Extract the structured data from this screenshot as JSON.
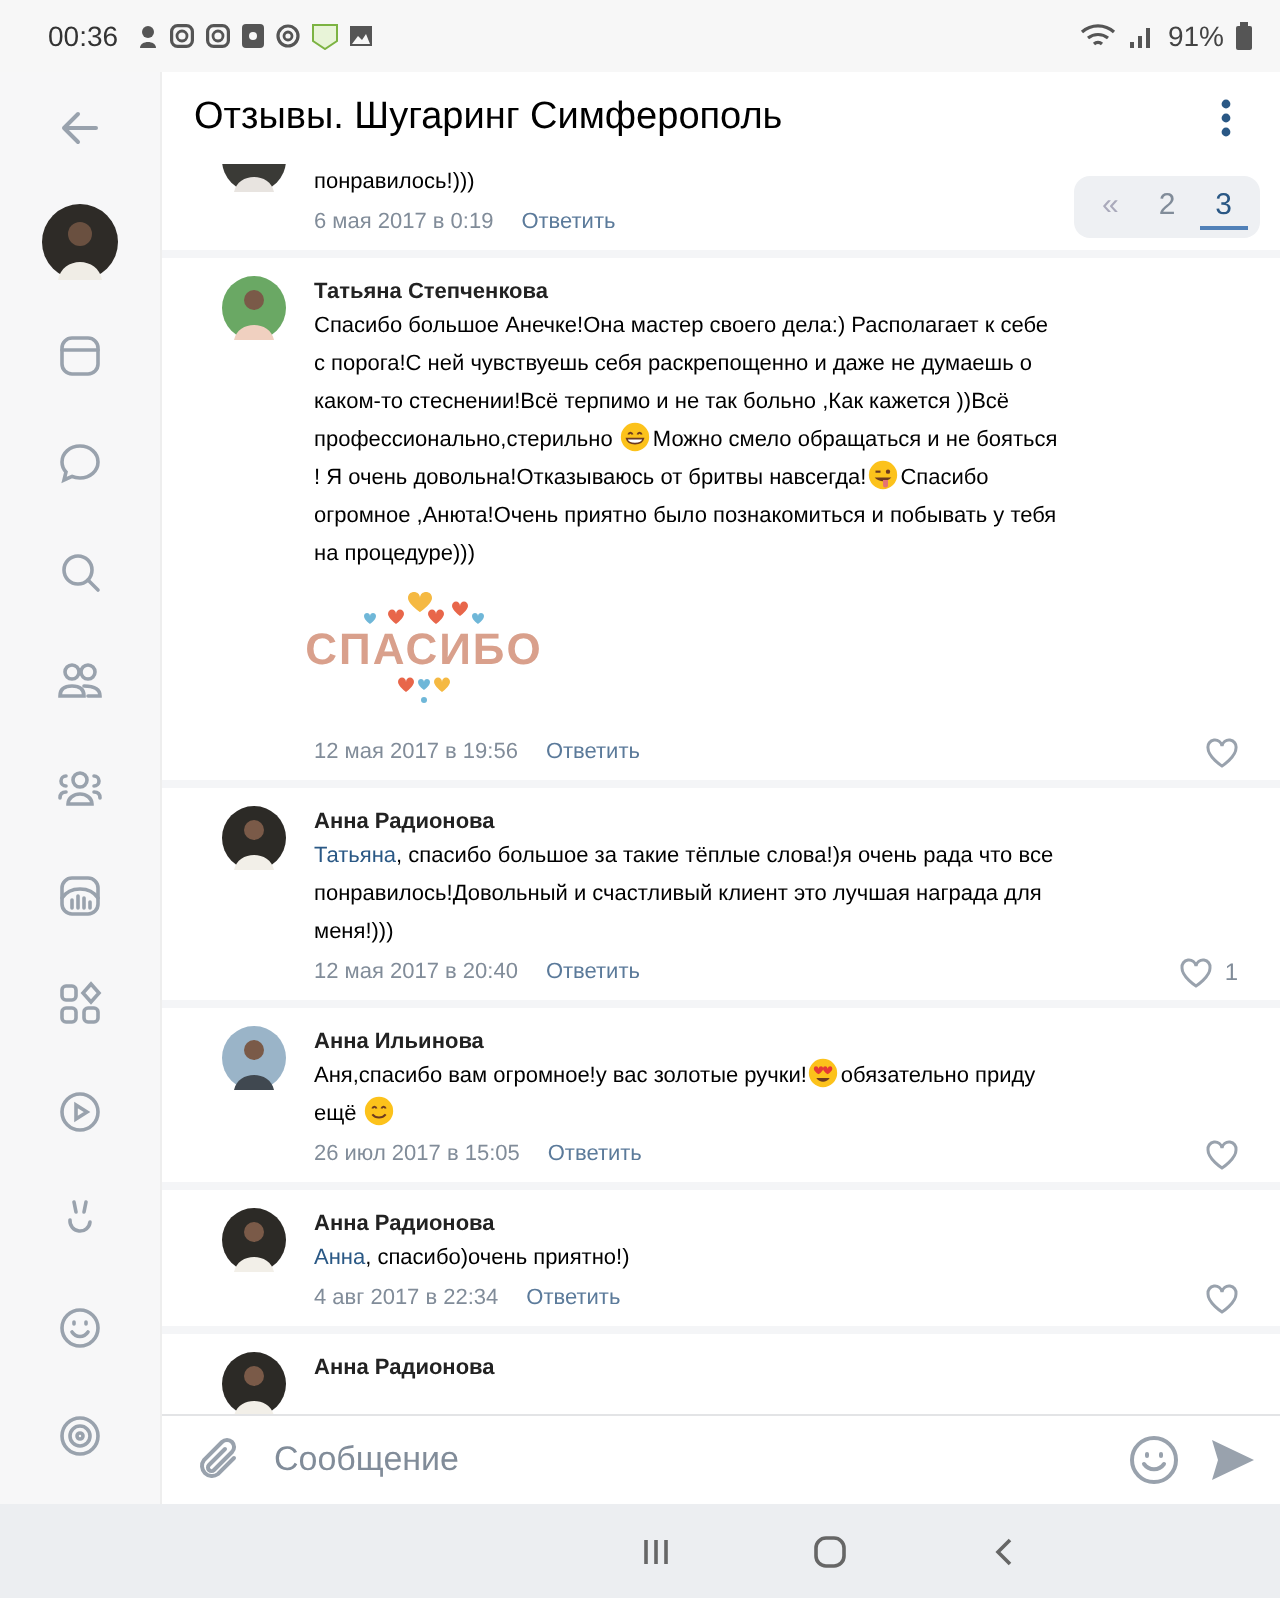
{
  "status_bar": {
    "time": "00:36",
    "battery": "91%"
  },
  "header": {
    "title": "Отзывы. Шугаринг Симферополь"
  },
  "pagination": {
    "prev": "«",
    "pages": [
      {
        "label": "2",
        "selected": false
      },
      {
        "label": "3",
        "selected": true
      }
    ]
  },
  "comments": [
    {
      "segments": [
        {
          "kind": "text",
          "text": "понравилось!)))"
        }
      ],
      "date": "6 мая 2017 в 0:19",
      "reply": "Ответить"
    },
    {
      "author": "Татьяна Степченкова",
      "segments": [
        {
          "kind": "text",
          "text": "Спасибо большое Анечке!Она мастер своего дела:) Располагает к себе с порога!С ней чувствуешь себя раскрепощенно и даже не думаешь о каком-то стеснении!Всё терпимо и не так больно ,Как кажется ))Всё профессионально,стерильно "
        },
        {
          "kind": "emoji-grin"
        },
        {
          "kind": "text",
          "text": "Можно смело обращаться и не бояться ! Я очень довольна!Отказываюсь от бритвы навсегда!"
        },
        {
          "kind": "emoji-wink"
        },
        {
          "kind": "text",
          "text": "Спасибо огромное ,Анюта!Очень приятно было познакомиться и побывать у тебя на процедуре)))"
        }
      ],
      "sticker": "СПАСИБО",
      "date": "12 мая 2017 в 19:56",
      "reply": "Ответить"
    },
    {
      "author": "Анна Радионова",
      "segments": [
        {
          "kind": "mention",
          "text": "Татьяна"
        },
        {
          "kind": "text",
          "text": ", спасибо большое за такие тёплые слова!)я очень рада что все понравилось!Довольный и счастливый клиент это лучшая награда для меня!)))"
        }
      ],
      "date": "12 мая 2017 в 20:40",
      "reply": "Ответить",
      "likes": "1"
    },
    {
      "author": "Анна Ильинова",
      "segments": [
        {
          "kind": "text",
          "text": "Аня,спасибо вам огромное!у вас золотые ручки!"
        },
        {
          "kind": "emoji-hearts"
        },
        {
          "kind": "text",
          "text": "обязательно приду ещё "
        },
        {
          "kind": "emoji-smile"
        }
      ],
      "date": "26 июл 2017 в 15:05",
      "reply": "Ответить"
    },
    {
      "author": "Анна Радионова",
      "segments": [
        {
          "kind": "mention",
          "text": "Анна"
        },
        {
          "kind": "text",
          "text": ", спасибо)очень приятно!)"
        }
      ],
      "date": "4 авг 2017 в 22:34",
      "reply": "Ответить"
    },
    {
      "author": "Анна Радионова"
    }
  ],
  "composer": {
    "placeholder": "Сообщение"
  }
}
